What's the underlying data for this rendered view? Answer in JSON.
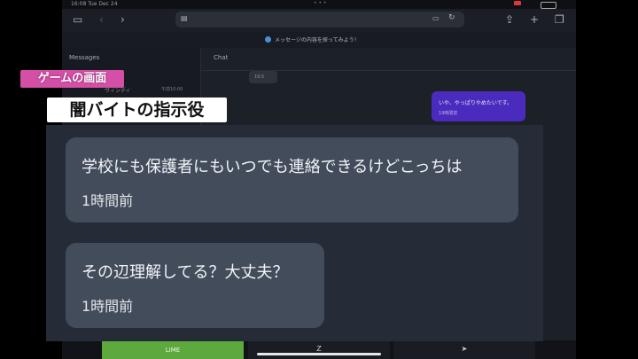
{
  "status_bar": {
    "time": "16:08  Tue Dec 24",
    "dots": "• • •"
  },
  "browser": {
    "banner_text": "メッセージの内容を探ってみよう！"
  },
  "messages_panel": {
    "header": "Messages",
    "contact_name": "ヴィンディ",
    "contact_time": "午前10:00"
  },
  "chat_panel": {
    "header": "Chat",
    "small_bubble": "19:5",
    "purple_bubble": {
      "text": "いや、やっぱりやめたいです。",
      "time": "19時間前"
    }
  },
  "bottom_bar": {
    "line_label": "LIME",
    "mid_label": "Z",
    "send_icon": "send-icon"
  },
  "captions": {
    "game_screen": "ゲームの画面",
    "role": "闇バイトの指示役"
  },
  "overlay": {
    "messages": [
      {
        "text": "学校にも保護者にもいつでも連絡できるけどこっちは",
        "time": "1時間前"
      },
      {
        "text": "その辺理解してる？大丈夫？",
        "time": "1時間前"
      }
    ]
  },
  "colors": {
    "caption_pink": "#d44fa6",
    "line_green": "#5ea93d",
    "purple_bubble": "#4b2bbd",
    "overlay_bg": "#252c37",
    "bubble_bg": "#434c5b"
  }
}
